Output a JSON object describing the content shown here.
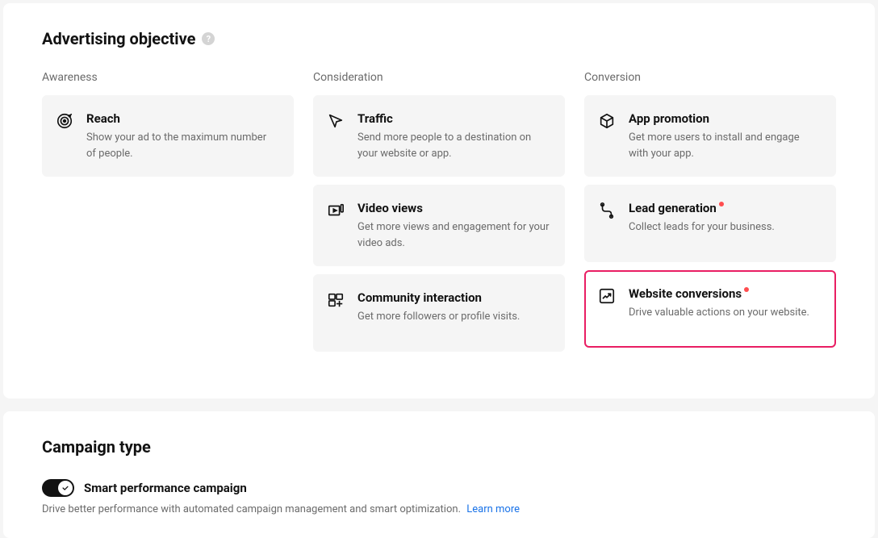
{
  "objective": {
    "title": "Advertising objective",
    "columns": {
      "awareness": {
        "label": "Awareness",
        "items": [
          {
            "title": "Reach",
            "desc": "Show your ad to the maximum number of people."
          }
        ]
      },
      "consideration": {
        "label": "Consideration",
        "items": [
          {
            "title": "Traffic",
            "desc": "Send more people to a destination on your website or app."
          },
          {
            "title": "Video views",
            "desc": "Get more views and engagement for your video ads."
          },
          {
            "title": "Community interaction",
            "desc": "Get more followers or profile visits."
          }
        ]
      },
      "conversion": {
        "label": "Conversion",
        "items": [
          {
            "title": "App promotion",
            "desc": "Get more users to install and engage with your app."
          },
          {
            "title": "Lead generation",
            "desc": "Collect leads for your business."
          },
          {
            "title": "Website conversions",
            "desc": "Drive valuable actions on your website."
          }
        ]
      }
    }
  },
  "campaignType": {
    "title": "Campaign type",
    "toggleLabel": "Smart performance campaign",
    "desc": "Drive better performance with automated campaign management and smart optimization.",
    "learnMore": "Learn more"
  }
}
